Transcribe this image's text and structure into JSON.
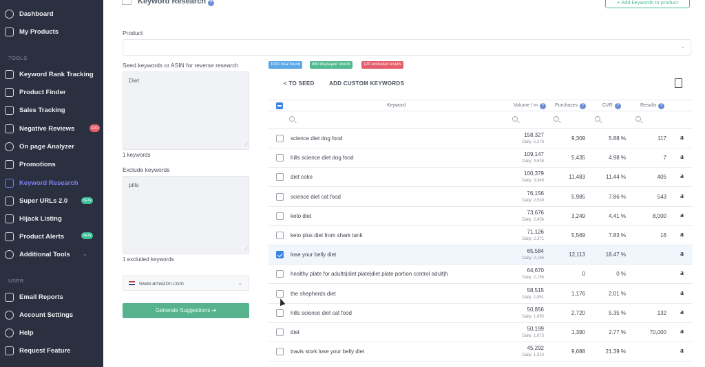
{
  "sidebar": {
    "top_items": [
      {
        "label": "Dashboard",
        "icon": "dashboard-icon"
      },
      {
        "label": "My Products",
        "icon": "products-icon"
      }
    ],
    "tools_label": "TOOLS",
    "tools": [
      {
        "label": "Keyword Rank Tracking",
        "icon": "rank-tracking-icon"
      },
      {
        "label": "Product Finder",
        "icon": "product-finder-icon"
      },
      {
        "label": "Sales Tracking",
        "icon": "sales-tracking-icon"
      },
      {
        "label": "Negative Reviews",
        "icon": "reviews-icon",
        "badge": "100"
      },
      {
        "label": "On page Analyzer",
        "icon": "eye-icon"
      },
      {
        "label": "Promotions",
        "icon": "promotions-icon"
      },
      {
        "label": "Keyword Research",
        "icon": "keyword-research-icon",
        "active": true
      },
      {
        "label": "Super URLs 2.0",
        "icon": "super-urls-icon",
        "badge": "NEW"
      },
      {
        "label": "Hijack Listing",
        "icon": "hijack-icon"
      },
      {
        "label": "Product Alerts",
        "icon": "bell-icon",
        "badge": "NEW"
      },
      {
        "label": "Additional Tools",
        "icon": "tools-icon"
      }
    ],
    "user_label": "USER",
    "user_items": [
      {
        "label": "Email Reports",
        "icon": "email-icon"
      },
      {
        "label": "Account Settings",
        "icon": "settings-icon"
      },
      {
        "label": "Help",
        "icon": "help-icon"
      },
      {
        "label": "Request Feature",
        "icon": "request-icon"
      }
    ]
  },
  "header": {
    "title": "Keyword Research",
    "add_button": "Add keywords to product"
  },
  "form": {
    "product_label": "Product",
    "seed_label": "Seed keywords or ASIN for reverse research",
    "seed_value": "Diet",
    "seed_count": "1 keywords",
    "exclude_label": "Exclude keywords",
    "exclude_value": "pills",
    "exclude_count": "1 excluded keywords",
    "marketplace": "www.amazon.com",
    "generate_button": "Generate Suggestions ➔"
  },
  "stats": {
    "total": "1000 total found",
    "displayed": "880 displayed results",
    "excluded": "120 excluded results"
  },
  "actions": {
    "to_seed": "< TO SEED",
    "add_custom": "ADD CUSTOM KEYWORDS"
  },
  "table": {
    "columns": {
      "keyword": "Keyword",
      "volume": "Volume / m",
      "purchases": "Purchases",
      "cvr": "CVR",
      "results": "Results"
    },
    "rows": [
      {
        "keyword": "science diet dog food",
        "volume": "158,327",
        "daily": "Daily: 5,278",
        "purchases": "9,309",
        "cvr": "5.88 %",
        "results": "117",
        "checked": false
      },
      {
        "keyword": "hills science diet dog food",
        "volume": "109,147",
        "daily": "Daily: 3,638",
        "purchases": "5,435",
        "cvr": "4.98 %",
        "results": "7",
        "checked": false
      },
      {
        "keyword": "diet coke",
        "volume": "100,379",
        "daily": "Daily: 3,346",
        "purchases": "11,483",
        "cvr": "11.44 %",
        "results": "405",
        "checked": false
      },
      {
        "keyword": "science diet cat food",
        "volume": "76,156",
        "daily": "Daily: 2,539",
        "purchases": "5,985",
        "cvr": "7.86 %",
        "results": "543",
        "checked": false
      },
      {
        "keyword": "keto diet",
        "volume": "73,676",
        "daily": "Daily: 2,456",
        "purchases": "3,249",
        "cvr": "4.41 %",
        "results": "8,000",
        "checked": false
      },
      {
        "keyword": "keto plus diet from shark tank",
        "volume": "71,126",
        "daily": "Daily: 2,371",
        "purchases": "5,569",
        "cvr": "7.83 %",
        "results": "16",
        "checked": false
      },
      {
        "keyword": "lose your belly diet",
        "volume": "65,584",
        "daily": "Daily: 2,186",
        "purchases": "12,113",
        "cvr": "18.47 %",
        "results": "",
        "checked": true
      },
      {
        "keyword": "healthy plate for adults|diet plate|diet plate portion control adult|h",
        "volume": "64,670",
        "daily": "Daily: 2,156",
        "purchases": "0",
        "cvr": "0 %",
        "results": "",
        "checked": false
      },
      {
        "keyword": "the shepherds diet",
        "volume": "58,515",
        "daily": "Daily: 1,951",
        "purchases": "1,176",
        "cvr": "2.01 %",
        "results": "",
        "checked": false
      },
      {
        "keyword": "hills science diet cat food",
        "volume": "50,856",
        "daily": "Daily: 1,695",
        "purchases": "2,720",
        "cvr": "5.35 %",
        "results": "132",
        "checked": false
      },
      {
        "keyword": "diet",
        "volume": "50,199",
        "daily": "Daily: 1,673",
        "purchases": "1,390",
        "cvr": "2.77 %",
        "results": "70,000",
        "checked": false
      },
      {
        "keyword": "travis stork lose your belly diet",
        "volume": "45,292",
        "daily": "Daily: 1,510",
        "purchases": "9,688",
        "cvr": "21.39 %",
        "results": "",
        "checked": false
      }
    ],
    "amazon_glyph": "a"
  },
  "colors": {
    "sidebar_bg": "#2b3040",
    "accent_purple": "#7d7ff0",
    "green": "#57b38e",
    "blue": "#5aa6e6",
    "red": "#e35d6a"
  }
}
